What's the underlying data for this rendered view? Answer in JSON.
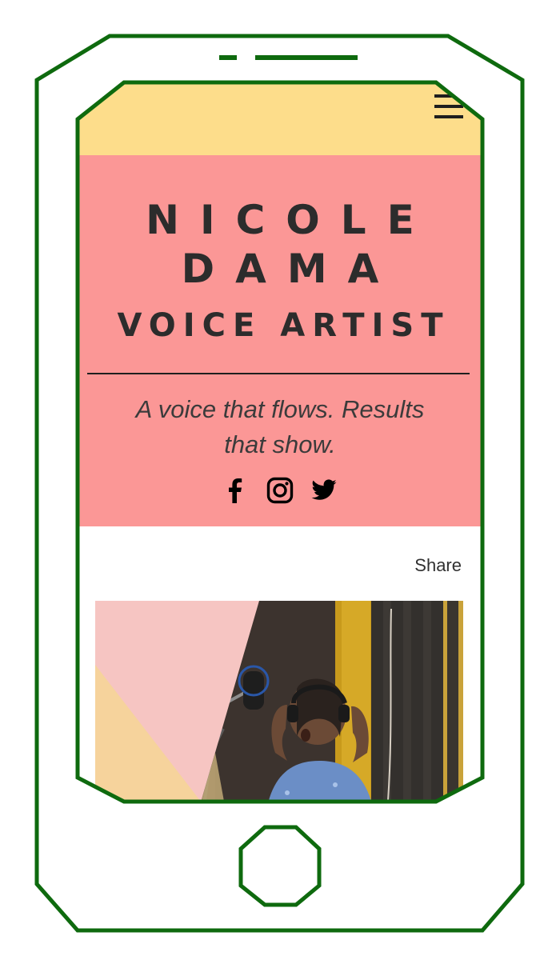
{
  "site": {
    "name_line1": "NICOLE",
    "name_line2": "DAMA",
    "subtitle": "VOICE ARTIST",
    "tagline": "A voice that flows. Results that show.",
    "share_label": "Share"
  },
  "icons": {
    "menu": "hamburger-menu-icon",
    "social": [
      "facebook-icon",
      "instagram-icon",
      "twitter-icon"
    ]
  },
  "colors": {
    "topbar": "#fddd8b",
    "hero": "#fb9796",
    "frame": "#0e6a0e",
    "text": "#2c2c2c"
  }
}
